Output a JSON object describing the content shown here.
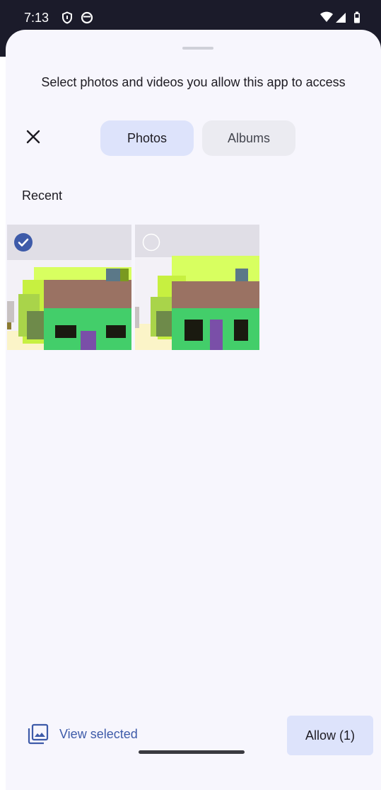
{
  "status_bar": {
    "time": "7:13",
    "left_icons": [
      "vpn-shield-icon",
      "data-saver-icon"
    ],
    "right_icons": [
      "wifi-icon",
      "cell-signal-icon",
      "battery-icon"
    ]
  },
  "sheet": {
    "title": "Select photos and videos you allow this app to access",
    "close_icon": "close-icon",
    "tabs": [
      {
        "label": "Photos",
        "selected": true
      },
      {
        "label": "Albums",
        "selected": false
      }
    ],
    "section_label": "Recent",
    "photos": [
      {
        "selected": true
      },
      {
        "selected": false
      }
    ]
  },
  "bottom": {
    "view_selected_label": "View selected",
    "allow_label": "Allow (1)"
  },
  "colors": {
    "accent": "#3e5ba9",
    "tab_selected": "#dde3fb",
    "sheet_bg": "#f7f6fd",
    "status_bg": "#1b1b2a"
  }
}
